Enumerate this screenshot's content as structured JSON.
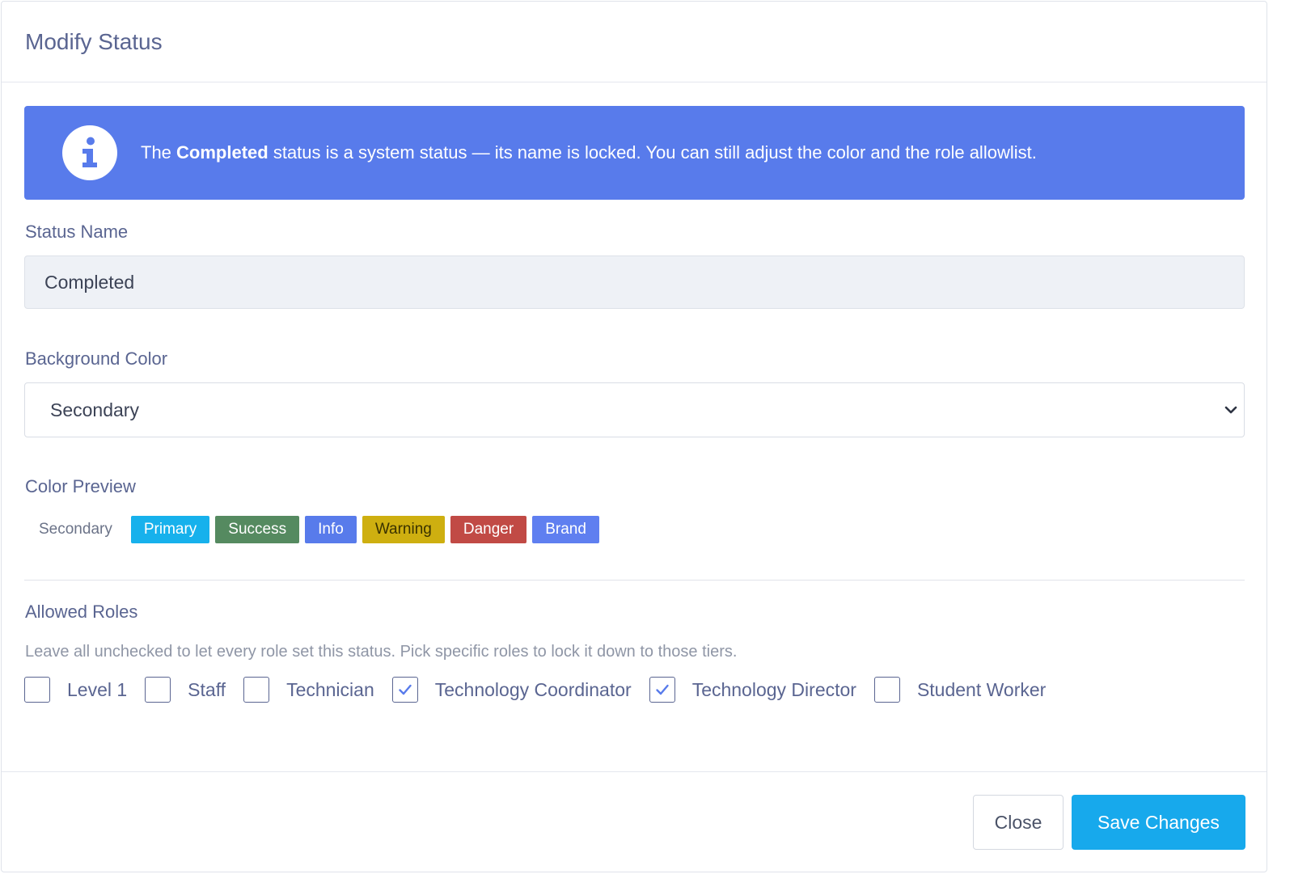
{
  "modal": {
    "title": "Modify Status"
  },
  "alert": {
    "text_before": "The ",
    "status_name": "Completed",
    "text_after": " status is a system status — its name is locked. You can still adjust the color and the role allowlist.",
    "icon": "info-circle-icon",
    "background": "#587beb"
  },
  "status_name": {
    "label": "Status Name",
    "value": "Completed"
  },
  "background_color": {
    "label": "Background Color",
    "selected": "Secondary"
  },
  "color_preview": {
    "label": "Color Preview",
    "badges": [
      {
        "label": "Secondary",
        "color": "#ffffff",
        "text_color": "#6b7388"
      },
      {
        "label": "Primary",
        "color": "#17b1ec",
        "text_color": "#ffffff"
      },
      {
        "label": "Success",
        "color": "#558a60",
        "text_color": "#ffffff"
      },
      {
        "label": "Info",
        "color": "#587beb",
        "text_color": "#ffffff"
      },
      {
        "label": "Warning",
        "color": "#ceaf10",
        "text_color": "#3a3200"
      },
      {
        "label": "Danger",
        "color": "#c14a45",
        "text_color": "#ffffff"
      },
      {
        "label": "Brand",
        "color": "#5f7ff0",
        "text_color": "#ffffff"
      }
    ]
  },
  "allowed_roles": {
    "label": "Allowed Roles",
    "help": "Leave all unchecked to let every role set this status. Pick specific roles to lock it down to those tiers.",
    "roles": [
      {
        "label": "Level 1",
        "checked": false
      },
      {
        "label": "Staff",
        "checked": false
      },
      {
        "label": "Technician",
        "checked": false
      },
      {
        "label": "Technology Coordinator",
        "checked": true
      },
      {
        "label": "Technology Director",
        "checked": true
      },
      {
        "label": "Student Worker",
        "checked": false
      }
    ]
  },
  "footer": {
    "close_label": "Close",
    "save_label": "Save Changes"
  }
}
